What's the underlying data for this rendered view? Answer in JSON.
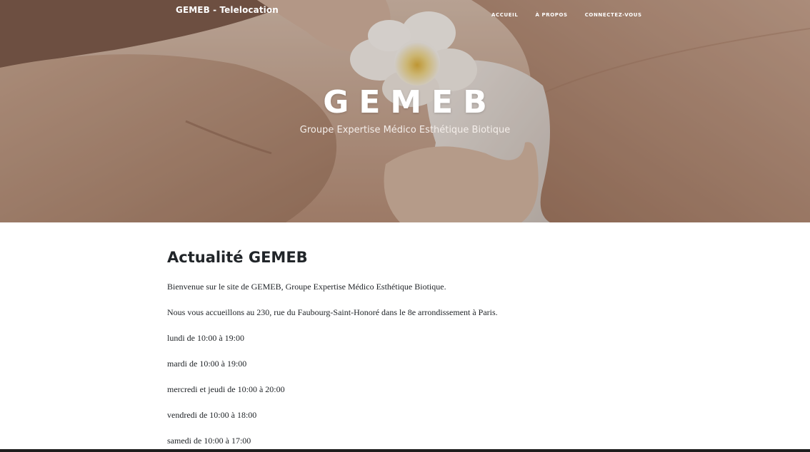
{
  "navbar": {
    "brand": "GEMEB - Telelocation",
    "links": [
      {
        "label": "ACCUEIL"
      },
      {
        "label": "À PROPOS"
      },
      {
        "label": "CONNECTEZ-VOUS"
      }
    ]
  },
  "hero": {
    "title": "GEMEB",
    "subtitle": "Groupe Expertise Médico Esthétique Biotique",
    "image": "spa-massage-flower-photo"
  },
  "content": {
    "title": "Actualité GEMEB",
    "paragraphs": [
      "Bienvenue sur le site de GEMEB, Groupe Expertise Médico Esthétique Biotique.",
      "Nous vous accueillons au 230, rue du Faubourg-Saint-Honoré dans le 8e arrondissement à Paris.",
      "lundi de 10:00 à 19:00",
      "mardi de 10:00 à 19:00",
      "mercredi et jeudi de 10:00 à 20:00",
      "vendredi de 10:00 à 18:00",
      "samedi de 10:00 à 17:00"
    ]
  },
  "colors": {
    "text": "#212529",
    "nav_text": "#ffffff",
    "hero_tint": "#a98471"
  }
}
